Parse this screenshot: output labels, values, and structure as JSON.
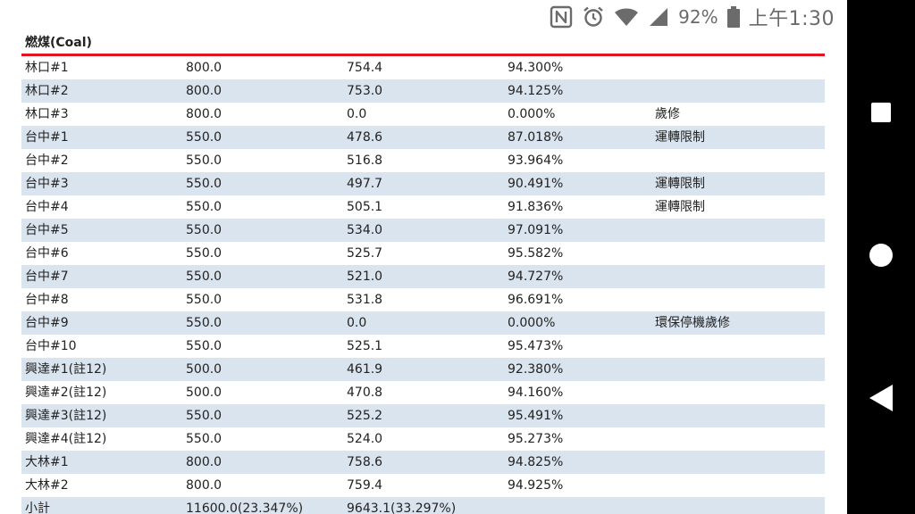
{
  "status_bar": {
    "battery_percent": "92%",
    "time": "上午1:30",
    "icons": [
      "nfc-icon",
      "alarm-icon",
      "wifi-icon",
      "cell-signal-icon",
      "battery-icon"
    ]
  },
  "section": {
    "title": "燃煤(Coal)",
    "accent_color": "#e0131f"
  },
  "table": {
    "rows": [
      {
        "name": "林口#1",
        "capacity": "800.0",
        "output": "754.4",
        "ratio": "94.300%",
        "note": ""
      },
      {
        "name": "林口#2",
        "capacity": "800.0",
        "output": "753.0",
        "ratio": "94.125%",
        "note": ""
      },
      {
        "name": "林口#3",
        "capacity": "800.0",
        "output": "0.0",
        "ratio": "0.000%",
        "note": "歲修"
      },
      {
        "name": "台中#1",
        "capacity": "550.0",
        "output": "478.6",
        "ratio": "87.018%",
        "note": "運轉限制"
      },
      {
        "name": "台中#2",
        "capacity": "550.0",
        "output": "516.8",
        "ratio": "93.964%",
        "note": ""
      },
      {
        "name": "台中#3",
        "capacity": "550.0",
        "output": "497.7",
        "ratio": "90.491%",
        "note": "運轉限制"
      },
      {
        "name": "台中#4",
        "capacity": "550.0",
        "output": "505.1",
        "ratio": "91.836%",
        "note": "運轉限制"
      },
      {
        "name": "台中#5",
        "capacity": "550.0",
        "output": "534.0",
        "ratio": "97.091%",
        "note": ""
      },
      {
        "name": "台中#6",
        "capacity": "550.0",
        "output": "525.7",
        "ratio": "95.582%",
        "note": ""
      },
      {
        "name": "台中#7",
        "capacity": "550.0",
        "output": "521.0",
        "ratio": "94.727%",
        "note": ""
      },
      {
        "name": "台中#8",
        "capacity": "550.0",
        "output": "531.8",
        "ratio": "96.691%",
        "note": ""
      },
      {
        "name": "台中#9",
        "capacity": "550.0",
        "output": "0.0",
        "ratio": "0.000%",
        "note": "環保停機歲修"
      },
      {
        "name": "台中#10",
        "capacity": "550.0",
        "output": "525.1",
        "ratio": "95.473%",
        "note": ""
      },
      {
        "name": "興達#1(註12)",
        "capacity": "500.0",
        "output": "461.9",
        "ratio": "92.380%",
        "note": ""
      },
      {
        "name": "興達#2(註12)",
        "capacity": "500.0",
        "output": "470.8",
        "ratio": "94.160%",
        "note": ""
      },
      {
        "name": "興達#3(註12)",
        "capacity": "550.0",
        "output": "525.2",
        "ratio": "95.491%",
        "note": ""
      },
      {
        "name": "興達#4(註12)",
        "capacity": "550.0",
        "output": "524.0",
        "ratio": "95.273%",
        "note": ""
      },
      {
        "name": "大林#1",
        "capacity": "800.0",
        "output": "758.6",
        "ratio": "94.825%",
        "note": ""
      },
      {
        "name": "大林#2",
        "capacity": "800.0",
        "output": "759.4",
        "ratio": "94.925%",
        "note": ""
      },
      {
        "name": "小計",
        "capacity": "11600.0(23.347%)",
        "output": "9643.1(33.297%)",
        "ratio": "",
        "note": ""
      }
    ]
  },
  "nav_bar": {
    "buttons": [
      "recents-icon",
      "home-icon",
      "back-icon"
    ]
  }
}
